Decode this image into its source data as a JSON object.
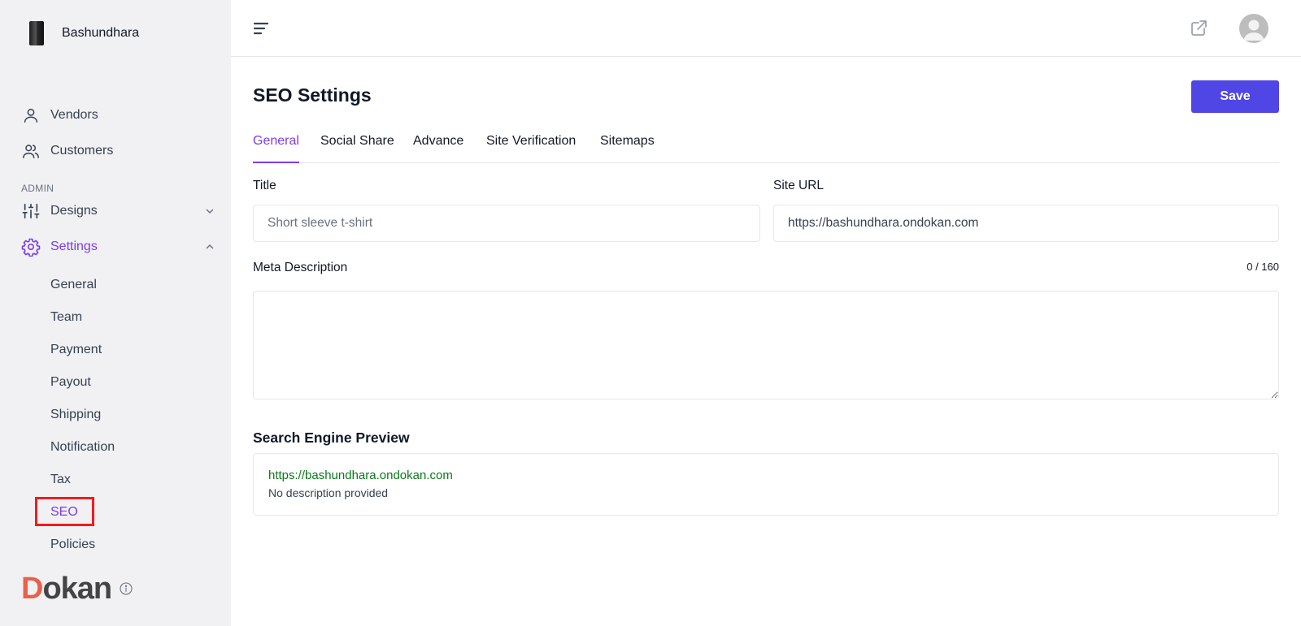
{
  "brand": {
    "name": "Bashundhara"
  },
  "sidebar": {
    "items": [
      {
        "label": "Vendors",
        "icon": "user-icon"
      },
      {
        "label": "Customers",
        "icon": "users-icon"
      }
    ],
    "section_label": "ADMIN",
    "admin_items": [
      {
        "label": "Designs",
        "icon": "sliders-icon",
        "expanded": false
      },
      {
        "label": "Settings",
        "icon": "gear-icon",
        "expanded": true,
        "active": true
      }
    ],
    "settings_sub": [
      {
        "label": "General"
      },
      {
        "label": "Team"
      },
      {
        "label": "Payment"
      },
      {
        "label": "Payout"
      },
      {
        "label": "Shipping"
      },
      {
        "label": "Notification"
      },
      {
        "label": "Tax"
      },
      {
        "label": "SEO",
        "active": true
      },
      {
        "label": "Policies"
      }
    ],
    "footer_logo": {
      "first": "D",
      "rest": "okan"
    }
  },
  "topbar": {
    "menu_icon": "hamburger-icon",
    "external_icon": "external-link-icon",
    "avatar_icon": "avatar-icon"
  },
  "page": {
    "title": "SEO Settings",
    "save_label": "Save",
    "tabs": [
      {
        "label": "General",
        "active": true
      },
      {
        "label": "Social Share"
      },
      {
        "label": "Advance"
      },
      {
        "label": "Site Verification"
      },
      {
        "label": "Sitemaps"
      }
    ],
    "form": {
      "title_label": "Title",
      "title_placeholder": "Short sleeve t-shirt",
      "title_value": "",
      "site_url_label": "Site URL",
      "site_url_value": "https://bashundhara.ondokan.com",
      "meta_label": "Meta Description",
      "meta_value": "",
      "meta_counter": "0 / 160"
    },
    "preview": {
      "heading": "Search Engine Preview",
      "url": "https://bashundhara.ondokan.com",
      "description": "No description provided"
    }
  },
  "colors": {
    "accent": "#7c3aed",
    "primary_button": "#4f46e5",
    "preview_url": "#0a7a1b",
    "highlight": "#ef1c1c",
    "dokan_d": "#ec5f4b"
  }
}
